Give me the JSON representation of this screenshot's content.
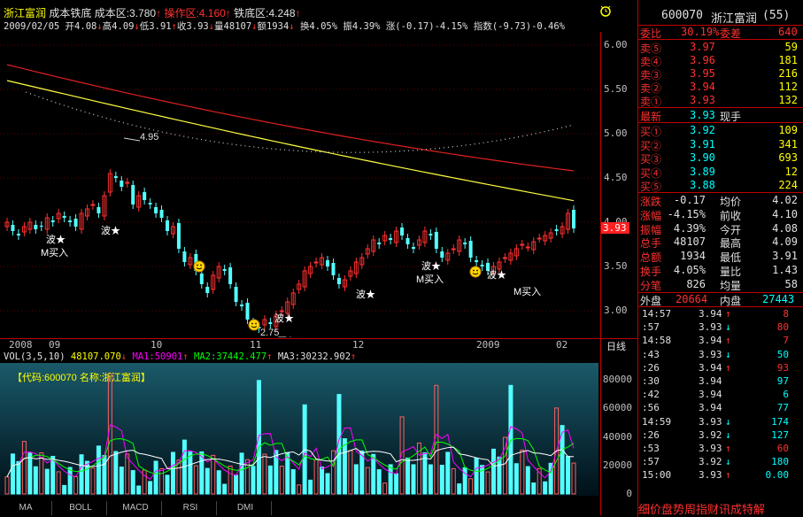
{
  "header": {
    "stock_name": "浙江富润",
    "cost_label": "成本铁底",
    "cost_zone": "成本区:3.780",
    "arrow_up": "↑",
    "op_zone": "操作区:4.160",
    "iron_zone": "铁底区:4.248",
    "arrow_dn": "↓",
    "alarm_icon": "alarm-clock-icon"
  },
  "quote": {
    "date": "2009/02/05",
    "open": "开4.08",
    "high": "高4.09",
    "low": "低3.91",
    "close": "收3.93",
    "volume": "量48107",
    "amount": "额1934",
    "turnover": "换4.05%",
    "amplitude": "振4.39%",
    "change": "涨(-0.17)-4.15%",
    "index": "指数(-9.73)-0.46%"
  },
  "price_axis": [
    "6.00",
    "5.50",
    "5.00",
    "4.50",
    "4.00",
    "3.50",
    "3.00"
  ],
  "price_marker": "3.93",
  "annotations": {
    "high_label": "4.95",
    "low_label": "2.75",
    "wave": "波★",
    "mbuy": "M买入",
    "smiley": "smiley-face-icon"
  },
  "dates": {
    "d2008": "2008",
    "d09": "09",
    "d10": "10",
    "d11": "11",
    "d12": "12",
    "d2009": "2009",
    "d02": "02",
    "period": "日线"
  },
  "vol_header": {
    "label": "VOL(3,5,10)",
    "vol": "48107.070",
    "ma1": "MA1:50901",
    "ma2": "MA2:37442.477",
    "ma3": "MA3:30232.902"
  },
  "vol_box": {
    "code": "【代码:600070",
    "name": "名称:浙江富润】"
  },
  "vol_axis": [
    "80000",
    "60000",
    "40000",
    "20000",
    "0"
  ],
  "tabs": [
    "MA",
    "BOLL",
    "MACD",
    "RSI",
    "DMI"
  ],
  "right": {
    "code": "600070",
    "name": "浙江富润",
    "count": "(55)",
    "webi_label": "委比",
    "webi": "30.19%",
    "wecha_label": "委差",
    "wecha": "640",
    "sells": [
      {
        "label": "卖⑤",
        "price": "3.97",
        "vol": "59"
      },
      {
        "label": "卖④",
        "price": "3.96",
        "vol": "181"
      },
      {
        "label": "卖③",
        "price": "3.95",
        "vol": "216"
      },
      {
        "label": "卖②",
        "price": "3.94",
        "vol": "112"
      },
      {
        "label": "卖①",
        "price": "3.93",
        "vol": "132"
      }
    ],
    "latest_label": "最新",
    "latest": "3.93",
    "hand_label": "现手",
    "buys": [
      {
        "label": "买①",
        "price": "3.92",
        "vol": "109"
      },
      {
        "label": "买②",
        "price": "3.91",
        "vol": "341"
      },
      {
        "label": "买③",
        "price": "3.90",
        "vol": "693"
      },
      {
        "label": "买④",
        "price": "3.89",
        "vol": "12"
      },
      {
        "label": "买⑤",
        "price": "3.88",
        "vol": "224"
      }
    ],
    "stats": [
      {
        "l1": "涨跌",
        "v1": "-0.17",
        "l2": "均价",
        "v2": "4.02"
      },
      {
        "l1": "涨幅",
        "v1": "-4.15%",
        "l2": "前收",
        "v2": "4.10"
      },
      {
        "l1": "振幅",
        "v1": "4.39%",
        "l2": "今开",
        "v2": "4.08"
      },
      {
        "l1": "总手",
        "v1": "48107",
        "l2": "最高",
        "v2": "4.09"
      },
      {
        "l1": "总额",
        "v1": "1934",
        "l2": "最低",
        "v2": "3.91"
      },
      {
        "l1": "换手",
        "v1": "4.05%",
        "l2": "量比",
        "v2": "1.43"
      },
      {
        "l1": "分笔",
        "v1": "826",
        "l2": "均量",
        "v2": "58"
      }
    ],
    "outer_label": "外盘",
    "outer": "20664",
    "inner_label": "内盘",
    "inner": "27443",
    "ticks": [
      {
        "t": "14:57",
        "p": "3.94",
        "d": "↑",
        "v": "8",
        "c": "red"
      },
      {
        "t": ":57",
        "p": "3.93",
        "d": "↓",
        "v": "80",
        "c": "red"
      },
      {
        "t": "14:58",
        "p": "3.94",
        "d": "↑",
        "v": "7",
        "c": "red"
      },
      {
        "t": ":43",
        "p": "3.93",
        "d": "↓",
        "v": "50",
        "c": "cyn"
      },
      {
        "t": ":26",
        "p": "3.94",
        "d": "↑",
        "v": "93",
        "c": "red"
      },
      {
        "t": ":30",
        "p": "3.94",
        "d": "",
        "v": "97",
        "c": "cyn"
      },
      {
        "t": ":42",
        "p": "3.94",
        "d": "",
        "v": "6",
        "c": "cyn"
      },
      {
        "t": ":56",
        "p": "3.94",
        "d": "",
        "v": "77",
        "c": "cyn"
      },
      {
        "t": "14:59",
        "p": "3.93",
        "d": "↓",
        "v": "174",
        "c": "cyn"
      },
      {
        "t": ":26",
        "p": "3.92",
        "d": "↓",
        "v": "127",
        "c": "cyn"
      },
      {
        "t": ":53",
        "p": "3.93",
        "d": "↑",
        "v": "60",
        "c": "red"
      },
      {
        "t": ":57",
        "p": "3.92",
        "d": "↓",
        "v": "180",
        "c": "cyn"
      },
      {
        "t": "15:00",
        "p": "3.93",
        "d": "↑",
        "v": "0.00",
        "c": "cyn"
      }
    ],
    "bottom_tabs": "细价盘势周指财讯成特解"
  }
}
